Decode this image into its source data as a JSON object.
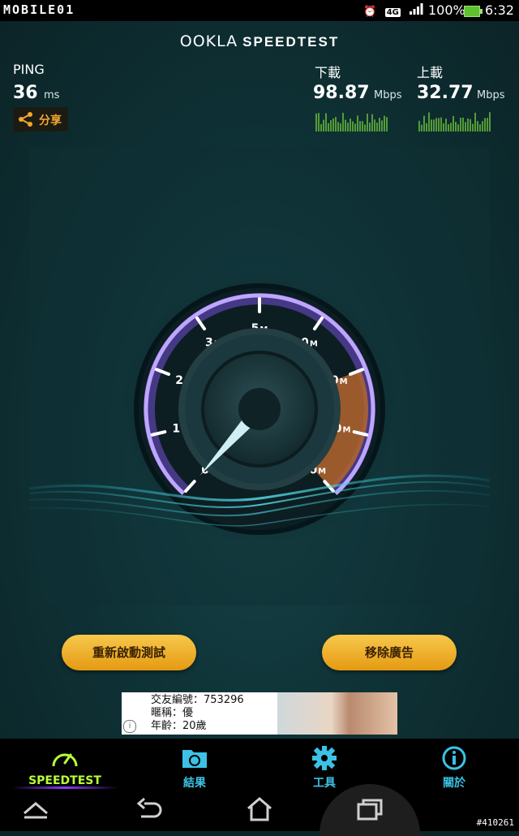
{
  "status_bar": {
    "logo_text": "MOBILE01",
    "network_badge": "4G",
    "battery_percent": "100%",
    "time": "6:32",
    "icons": [
      "alarm-icon",
      "network-4g-icon",
      "signal-icon",
      "battery-icon"
    ]
  },
  "header": {
    "brand_left": "OOKLA",
    "brand_right": "SPEEDTEST"
  },
  "ping": {
    "label": "PING",
    "value": "36",
    "unit": "ms"
  },
  "share": {
    "label": "分享"
  },
  "download": {
    "label": "下載",
    "value": "98.87",
    "unit": "Mbps"
  },
  "upload": {
    "label": "上載",
    "value": "32.77",
    "unit": "Mbps"
  },
  "gauge": {
    "ticks": [
      {
        "value": "0",
        "unit": ""
      },
      {
        "value": "1",
        "unit": "M"
      },
      {
        "value": "2",
        "unit": "M"
      },
      {
        "value": "3",
        "unit": "M"
      },
      {
        "value": "5",
        "unit": "M"
      },
      {
        "value": "10",
        "unit": "M"
      },
      {
        "value": "20",
        "unit": "M"
      },
      {
        "value": "30",
        "unit": "M"
      },
      {
        "value": "50",
        "unit": "M"
      }
    ],
    "needle_position": 0.0
  },
  "buttons": {
    "restart": "重新啟動測試",
    "remove_ads": "移除廣告"
  },
  "ad": {
    "line1": "交友編號：753296",
    "line2": "暱稱：優",
    "line3": "年齡：20歲",
    "info": "i"
  },
  "tabs": [
    {
      "label": "SPEEDTEST",
      "icon": "speedometer-icon",
      "active": true
    },
    {
      "label": "結果",
      "icon": "folder-results-icon",
      "active": false
    },
    {
      "label": "工具",
      "icon": "gear-icon",
      "active": false
    },
    {
      "label": "關於",
      "icon": "info-icon",
      "active": false
    }
  ],
  "watermark": "#410261",
  "colors": {
    "accent_green": "#b9ff39",
    "accent_blue": "#3cc2e6",
    "button_orange": "#f0ad2a",
    "share_orange": "#f3a72c"
  }
}
